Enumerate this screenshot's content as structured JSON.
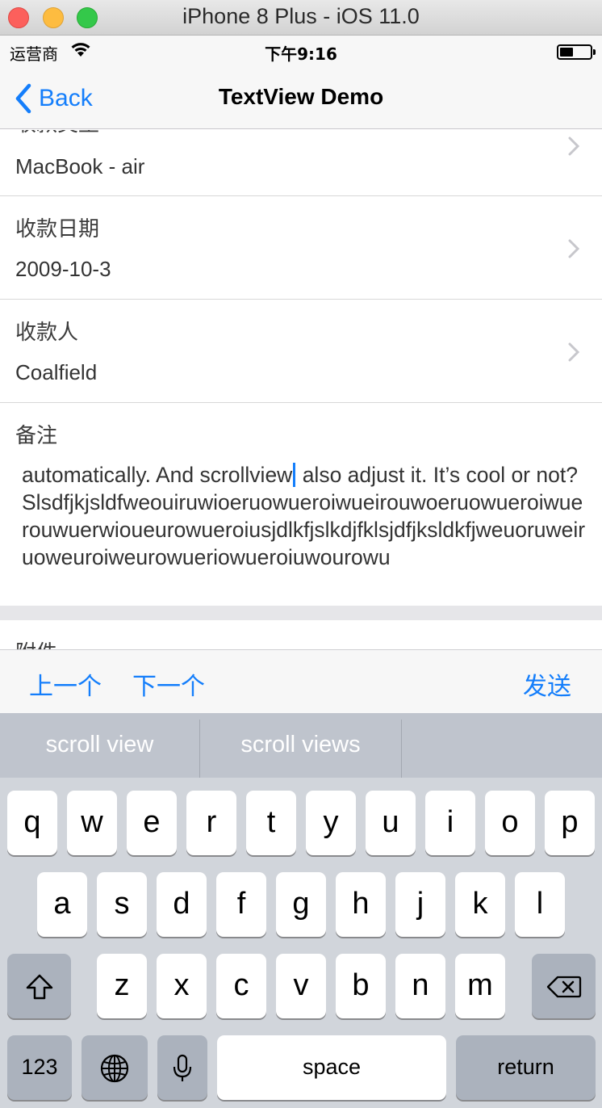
{
  "window": {
    "title": "iPhone 8 Plus - iOS 11.0"
  },
  "status_bar": {
    "carrier": "运营商",
    "time": "下午9:16"
  },
  "nav": {
    "back_label": "Back",
    "title": "TextView Demo"
  },
  "cells": [
    {
      "label": "收款类型",
      "value": "MacBook - air"
    },
    {
      "label": "收款日期",
      "value": "2009-10-3"
    },
    {
      "label": "收款人",
      "value": "Coalfield"
    }
  ],
  "remark": {
    "label": "备注",
    "text_before_cursor": "automatically. And scrollview",
    "text_after_cursor": " also adjust it. It’s cool or not? Slsdfjkjsldfweouiruwioeruowueroiwueirouwoeruowueroiwuerouwuerwioueurowueroiusjdlkfjslkdjfklsjdfjksldkfjweuoruweiruoweuroiweurowueriowueroiuwourowu"
  },
  "attachment": {
    "label": "附件"
  },
  "toolbar": {
    "prev": "上一个",
    "next": "下一个",
    "send": "发送"
  },
  "keyboard": {
    "suggestions": [
      "scroll view",
      "scroll views",
      ""
    ],
    "row1": [
      "q",
      "w",
      "e",
      "r",
      "t",
      "y",
      "u",
      "i",
      "o",
      "p"
    ],
    "row2": [
      "a",
      "s",
      "d",
      "f",
      "g",
      "h",
      "j",
      "k",
      "l"
    ],
    "row3": [
      "z",
      "x",
      "c",
      "v",
      "b",
      "n",
      "m"
    ],
    "numbers_key": "123",
    "space_key": "space",
    "return_key": "return",
    "icons": [
      "shift-icon",
      "delete-icon",
      "globe-icon",
      "microphone-icon"
    ]
  },
  "colors": {
    "accent": "#147efb",
    "keyboard_bg": "#d1d5db",
    "nav_bg": "#f7f7f7"
  }
}
